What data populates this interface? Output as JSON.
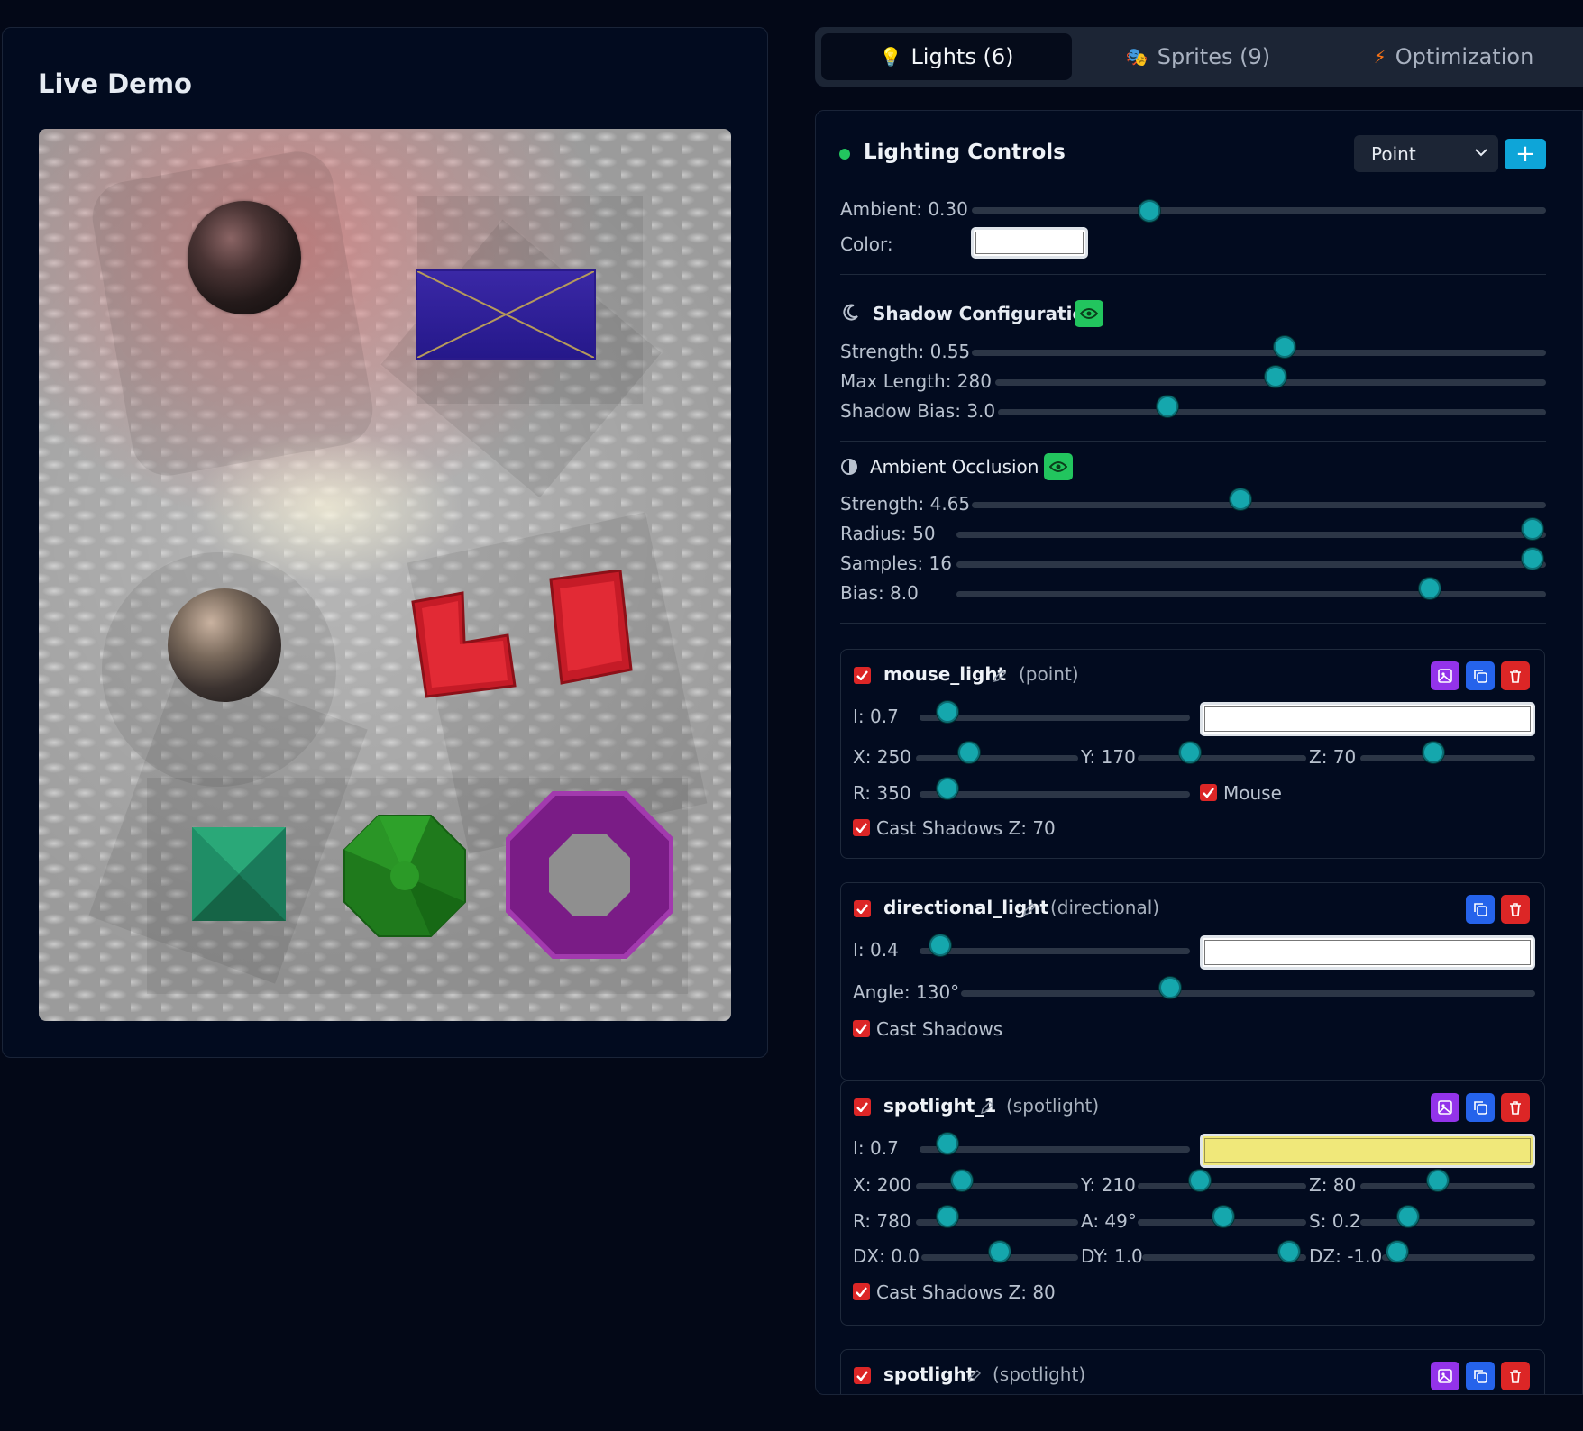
{
  "demo": {
    "title": "Live Demo"
  },
  "tabs": [
    {
      "icon": "💡",
      "label": "Lights (6)"
    },
    {
      "icon": "🎭",
      "label": "Sprites (9)"
    },
    {
      "icon": "⚡",
      "label": "Optimization"
    }
  ],
  "controls": {
    "title": "Lighting Controls",
    "light_type_select": "Point",
    "add_label": "+",
    "ambient": {
      "label": "Ambient: 0.30",
      "value": 0.3
    },
    "color_label": "Color:",
    "color_value": "#ffffff"
  },
  "shadow": {
    "title": "Shadow Configuration",
    "strength": {
      "label": "Strength: 0.55",
      "value": 0.55
    },
    "max_length": {
      "label": "Max Length: 280",
      "value": 280
    },
    "bias": {
      "label": "Shadow Bias: 3.0",
      "value": 3.0
    }
  },
  "ao": {
    "title": "Ambient Occlusion",
    "strength": {
      "label": "Strength: 4.65",
      "value": 4.65
    },
    "radius": {
      "label": "Radius: 50",
      "value": 50
    },
    "samples": {
      "label": "Samples: 16",
      "value": 16
    },
    "bias": {
      "label": "Bias: 8.0",
      "value": 8.0
    }
  },
  "lights": [
    {
      "name": "mouse_light",
      "type": "(point)",
      "enabled": true,
      "color": "#ffffff",
      "intensity": "I: 0.7",
      "x": "X: 250",
      "y": "Y: 170",
      "z": "Z: 70",
      "r": "R: 350",
      "mouse_label": "Mouse",
      "cast_shadows": "Cast Shadows Z: 70"
    },
    {
      "name": "directional_light",
      "type": "(directional)",
      "enabled": true,
      "color": "#ffffff",
      "intensity": "I: 0.4",
      "angle": "Angle: 130°",
      "cast_shadows": "Cast Shadows"
    },
    {
      "name": "spotlight_1",
      "type": "(spotlight)",
      "enabled": true,
      "color": "#f0e87a",
      "intensity": "I: 0.7",
      "x": "X: 200",
      "y": "Y: 210",
      "z": "Z: 80",
      "r": "R: 780",
      "a": "A: 49°",
      "s": "S: 0.2",
      "dx": "DX: 0.0",
      "dy": "DY: 1.0",
      "dz": "DZ: -1.0",
      "cast_shadows": "Cast Shadows Z: 80"
    },
    {
      "name": "spotlight",
      "type": "(spotlight)",
      "enabled": true
    }
  ],
  "colors": {
    "accent": "#15a7ad",
    "success": "#22c55e",
    "danger": "#dc2626",
    "primary": "#2563eb",
    "purple": "#9333ea"
  }
}
